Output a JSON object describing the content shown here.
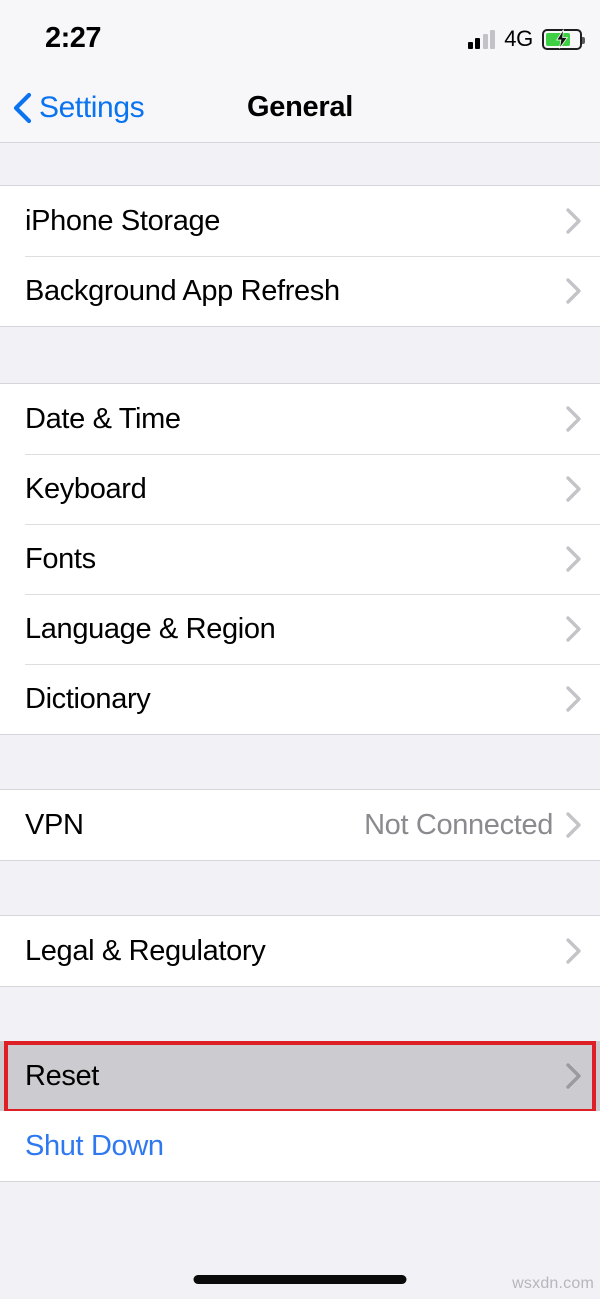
{
  "statusbar": {
    "time": "2:27",
    "network": "4G",
    "signal_bars_filled": 2,
    "signal_bars_total": 4,
    "battery_charging": true,
    "battery_level_pct": 76,
    "battery_color": "#3ecf45"
  },
  "navbar": {
    "back_label": "Settings",
    "title": "General",
    "accent_color": "#0a74f0"
  },
  "sections": [
    {
      "rows": [
        {
          "label": "iPhone Storage",
          "value": "",
          "chevron": true
        },
        {
          "label": "Background App Refresh",
          "value": "",
          "chevron": true
        }
      ]
    },
    {
      "rows": [
        {
          "label": "Date & Time",
          "value": "",
          "chevron": true
        },
        {
          "label": "Keyboard",
          "value": "",
          "chevron": true
        },
        {
          "label": "Fonts",
          "value": "",
          "chevron": true
        },
        {
          "label": "Language & Region",
          "value": "",
          "chevron": true
        },
        {
          "label": "Dictionary",
          "value": "",
          "chevron": true
        }
      ]
    },
    {
      "rows": [
        {
          "label": "VPN",
          "value": "Not Connected",
          "chevron": true
        }
      ]
    },
    {
      "rows": [
        {
          "label": "Legal & Regulatory",
          "value": "",
          "chevron": true
        }
      ]
    },
    {
      "rows": [
        {
          "label": "Reset",
          "value": "",
          "chevron": true
        }
      ]
    },
    {
      "rows": [
        {
          "label": "Shut Down",
          "value": "",
          "chevron": false
        }
      ]
    }
  ],
  "highlight": {
    "target_label": "Reset",
    "border_color": "#dd1f26",
    "row_background": "#cbcbd0"
  },
  "footer": {
    "watermark": "wsxdn.com"
  }
}
